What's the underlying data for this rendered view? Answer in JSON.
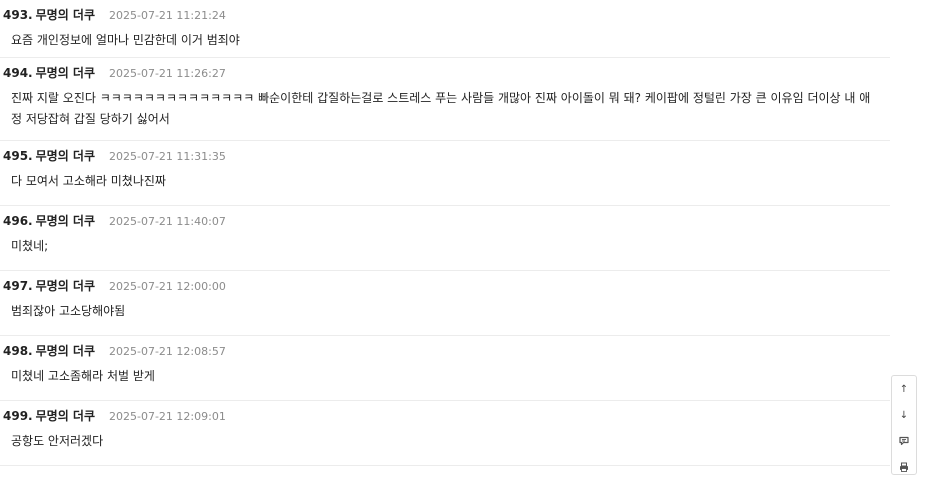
{
  "comments": [
    {
      "number": "493.",
      "author": "무명의 더쿠",
      "timestamp": "2025-07-21 11:21:24",
      "text": "요즘 개인정보에 얼마나 민감한데 이거 범죄야"
    },
    {
      "number": "494.",
      "author": "무명의 더쿠",
      "timestamp": "2025-07-21 11:26:27",
      "text": "진짜 지랄 오진다 ㅋㅋㅋㅋㅋㅋㅋㅋㅋㅋㅋㅋㅋㅋ 빠순이한테 갑질하는걸로 스트레스 푸는 사람들 개많아 진짜 아이돌이 뭐 돼? 케이팝에 정털린 가장 큰 이유임 더이상 내 애정 저당잡혀 갑질 당하기 싫어서"
    },
    {
      "number": "495.",
      "author": "무명의 더쿠",
      "timestamp": "2025-07-21 11:31:35",
      "text": "다 모여서 고소해라 미쳤나진짜"
    },
    {
      "number": "496.",
      "author": "무명의 더쿠",
      "timestamp": "2025-07-21 11:40:07",
      "text": "미쳤네;"
    },
    {
      "number": "497.",
      "author": "무명의 더쿠",
      "timestamp": "2025-07-21 12:00:00",
      "text": "범죄잖아 고소당해야됨"
    },
    {
      "number": "498.",
      "author": "무명의 더쿠",
      "timestamp": "2025-07-21 12:08:57",
      "text": "미쳤네 고소좀해라 처벌 받게"
    },
    {
      "number": "499.",
      "author": "무명의 더쿠",
      "timestamp": "2025-07-21 12:09:01",
      "text": "공항도 안저러겠다"
    }
  ],
  "side_tools": {
    "up": "↑",
    "down": "↓",
    "comment_icon": "speech-bubble-icon",
    "print_icon": "printer-icon"
  }
}
